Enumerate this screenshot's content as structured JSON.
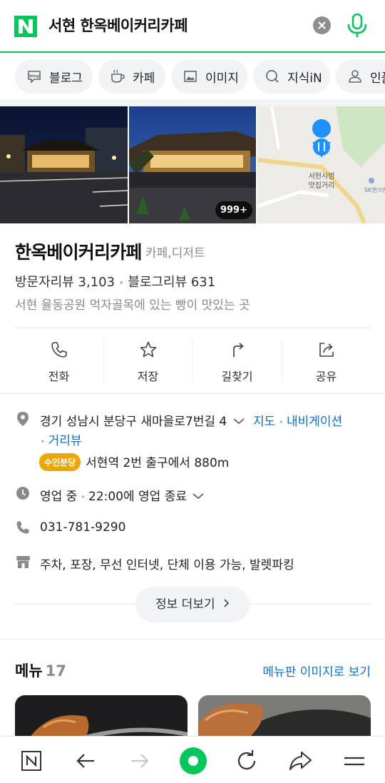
{
  "search": {
    "query": "서현 한옥베이커리카페"
  },
  "tabs": [
    {
      "label": "블로그",
      "icon": "blog-icon"
    },
    {
      "label": "카페",
      "icon": "coffee-cup-icon"
    },
    {
      "label": "이미지",
      "icon": "image-icon"
    },
    {
      "label": "지식iN",
      "icon": "q-search-icon"
    },
    {
      "label": "인플",
      "icon": "person-icon"
    }
  ],
  "photos": {
    "count_badge": "999+",
    "map_label_line1": "서현시범",
    "map_label_line2": "맛집거리",
    "map_poi": "SK엔크린"
  },
  "place": {
    "name": "한옥베이커리카페",
    "category": "카페,디저트",
    "visitor_reviews": "방문자리뷰 3,103",
    "blog_reviews": "블로그리뷰 631",
    "description": "서현 율동공원 먹자골목에 있는 빵이 맛있는 곳"
  },
  "actions": [
    {
      "label": "전화",
      "icon": "phone-icon"
    },
    {
      "label": "저장",
      "icon": "star-icon"
    },
    {
      "label": "길찾기",
      "icon": "directions-icon"
    },
    {
      "label": "공유",
      "icon": "share-icon"
    }
  ],
  "details": {
    "address": "경기 성남시 분당구 새마을로7번길 4",
    "map_link": "지도",
    "navigation_link": "내비게이션",
    "street_view_link": "거리뷰",
    "subway_badge": "수인분당",
    "subway_text": "서현역 2번 출구에서 880m",
    "hours_status": "영업 중",
    "hours_text": "22:00에 영업 종료",
    "phone": "031-781-9290",
    "amenities": "주차, 포장, 무선 인터넷, 단체 이용 가능, 발렛파킹",
    "more_info": "정보 더보기"
  },
  "menu": {
    "title": "메뉴",
    "count": "17",
    "board_link": "메뉴판 이미지로 보기"
  },
  "colors": {
    "brand_green": "#03c75a",
    "link_blue": "#0b6fd6",
    "subway_yellow": "#f0a600"
  }
}
